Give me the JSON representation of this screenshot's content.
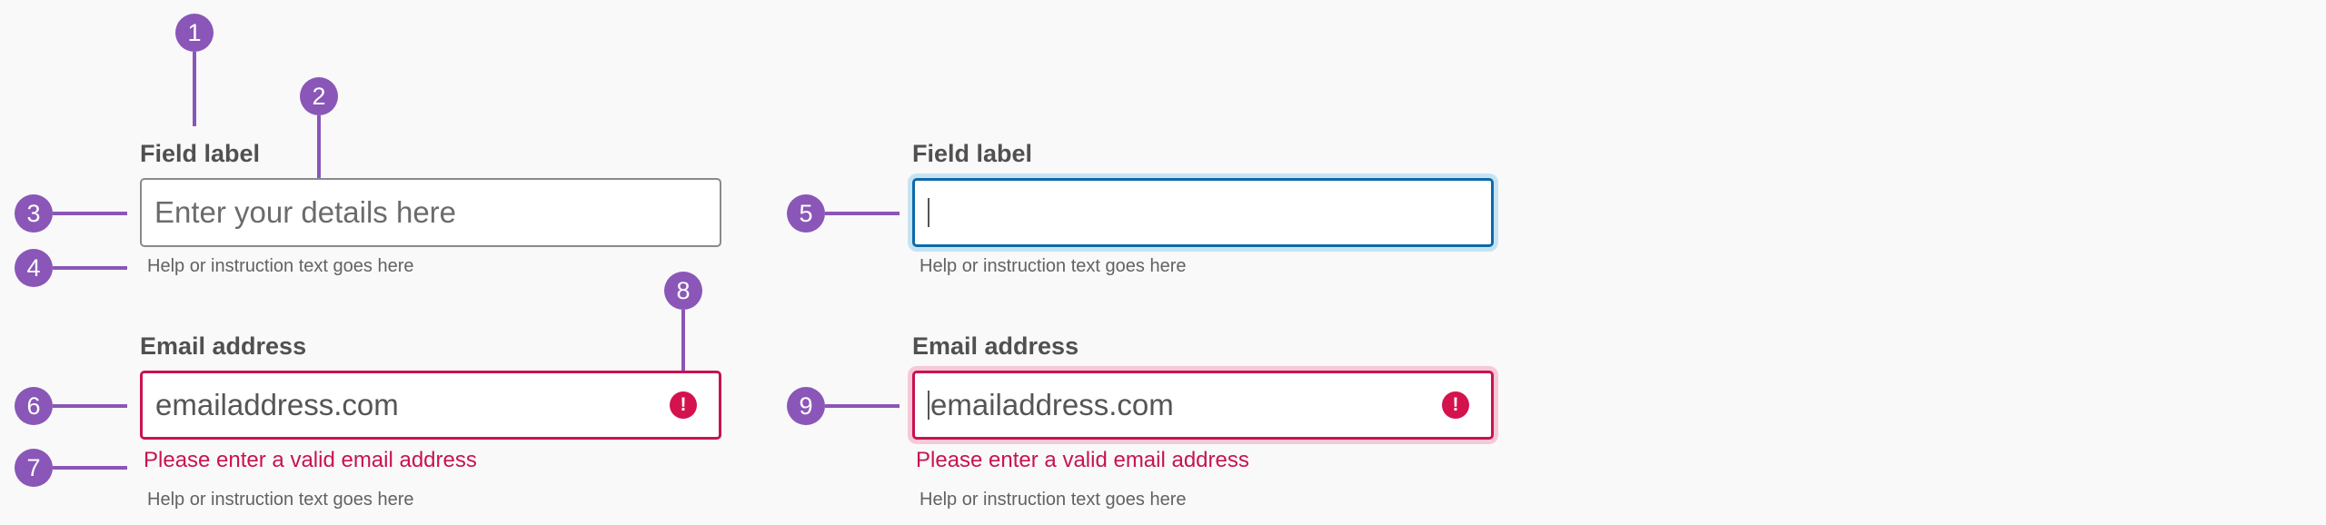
{
  "colors": {
    "marker": "#8a56b8",
    "label": "#505050",
    "help": "#626262",
    "error": "#c8134f",
    "focus_border": "#0f69a8",
    "focus_ring": "#c6e3f3",
    "error_focus_ring": "#f7c8d8",
    "background": "#f9f9f9"
  },
  "markers": [
    "1",
    "2",
    "3",
    "4",
    "5",
    "6",
    "7",
    "8",
    "9"
  ],
  "default_field": {
    "label": "Field label",
    "placeholder": "Enter your details here",
    "help": "Help or instruction text goes here"
  },
  "focused_field": {
    "label": "Field label",
    "value": "",
    "help": "Help or instruction text goes here"
  },
  "error_field": {
    "label": "Email address",
    "value": "emailaddress.com",
    "error": "Please enter a valid email address",
    "help": "Help or instruction text goes here",
    "icon": "error-alert-icon",
    "icon_glyph": "!"
  },
  "error_focused_field": {
    "label": "Email address",
    "value": "emailaddress.com",
    "error": "Please enter a valid email address",
    "help": "Help or instruction text goes here",
    "icon": "error-alert-icon",
    "icon_glyph": "!"
  }
}
